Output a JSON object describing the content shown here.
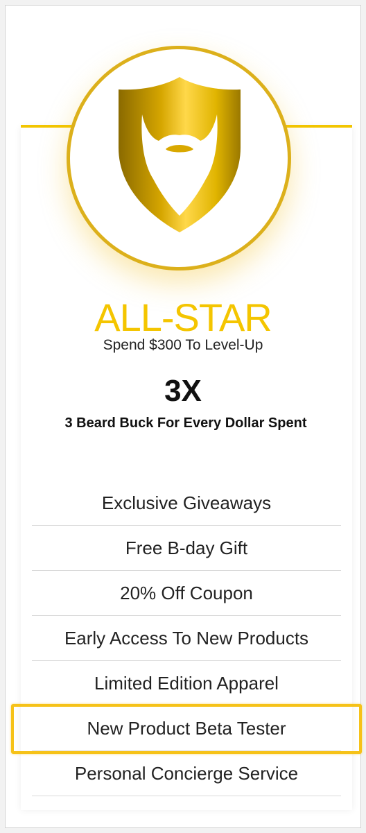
{
  "colors": {
    "gold": "#f4c500",
    "badge_border": "#dcb01b",
    "highlight": "#f6c218"
  },
  "tier": {
    "icon": "beard-shield-icon",
    "name": "ALL-STAR",
    "level_up": "Spend $300 To Level-Up",
    "multiplier": "3X",
    "multiplier_description": "3 Beard Buck For Every Dollar Spent"
  },
  "benefits": [
    "Exclusive Giveaways",
    "Free B-day Gift",
    "20% Off Coupon",
    "Early Access To New Products",
    "Limited Edition Apparel",
    "New Product Beta Tester",
    "Personal Concierge Service"
  ],
  "highlighted_benefit": "New Product Beta Tester"
}
